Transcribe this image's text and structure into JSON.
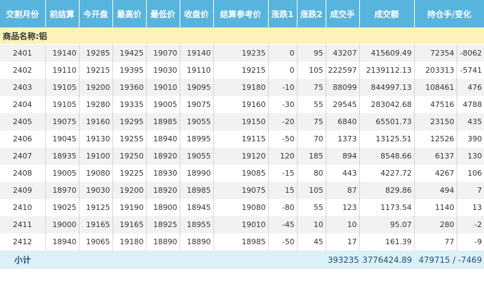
{
  "headers": [
    "交割月份",
    "前结算",
    "今开盘",
    "最高价",
    "最低价",
    "收盘价",
    "结算参考价",
    "涨跌1",
    "涨跌2",
    "成交手",
    "成交额",
    "持仓手/变化"
  ],
  "group_label": "商品名称:铝",
  "rows": [
    [
      "2401",
      "19140",
      "19285",
      "19425",
      "19070",
      "19140",
      "19235",
      "0",
      "95",
      "43207",
      "415609.49",
      "72354",
      "-8062"
    ],
    [
      "2402",
      "19110",
      "19215",
      "19395",
      "19030",
      "19110",
      "19215",
      "0",
      "105",
      "222597",
      "2139112.13",
      "203313",
      "-5741"
    ],
    [
      "2403",
      "19105",
      "19200",
      "19360",
      "19010",
      "19095",
      "19180",
      "-10",
      "75",
      "88099",
      "844997.13",
      "108461",
      "476"
    ],
    [
      "2404",
      "19105",
      "19280",
      "19335",
      "19005",
      "19075",
      "19160",
      "-30",
      "55",
      "29545",
      "283042.68",
      "47516",
      "4788"
    ],
    [
      "2405",
      "19075",
      "19160",
      "19295",
      "18985",
      "19055",
      "19150",
      "-20",
      "75",
      "6840",
      "65501.73",
      "23150",
      "435"
    ],
    [
      "2406",
      "19045",
      "19130",
      "19255",
      "18940",
      "18995",
      "19115",
      "-50",
      "70",
      "1373",
      "13125.51",
      "12526",
      "390"
    ],
    [
      "2407",
      "18935",
      "19100",
      "19250",
      "18920",
      "19055",
      "19120",
      "120",
      "185",
      "894",
      "8548.66",
      "6137",
      "130"
    ],
    [
      "2408",
      "19005",
      "19080",
      "19225",
      "18930",
      "18990",
      "19085",
      "-15",
      "80",
      "443",
      "4227.72",
      "4267",
      "106"
    ],
    [
      "2409",
      "18970",
      "19030",
      "19200",
      "18920",
      "18985",
      "19075",
      "15",
      "105",
      "87",
      "829.86",
      "494",
      "7"
    ],
    [
      "2410",
      "19025",
      "19125",
      "19190",
      "18900",
      "18945",
      "19080",
      "-80",
      "55",
      "123",
      "1173.54",
      "1140",
      "13"
    ],
    [
      "2411",
      "19000",
      "19165",
      "19165",
      "18925",
      "18955",
      "19010",
      "-45",
      "10",
      "10",
      "95.07",
      "280",
      "-2"
    ],
    [
      "2412",
      "18940",
      "19065",
      "19180",
      "18890",
      "18890",
      "18985",
      "-50",
      "45",
      "17",
      "161.39",
      "77",
      "-9"
    ]
  ],
  "footer": {
    "label": "小计",
    "volume": "393235",
    "turnover": "3776424.89",
    "open_interest": "479715 / -7469"
  }
}
